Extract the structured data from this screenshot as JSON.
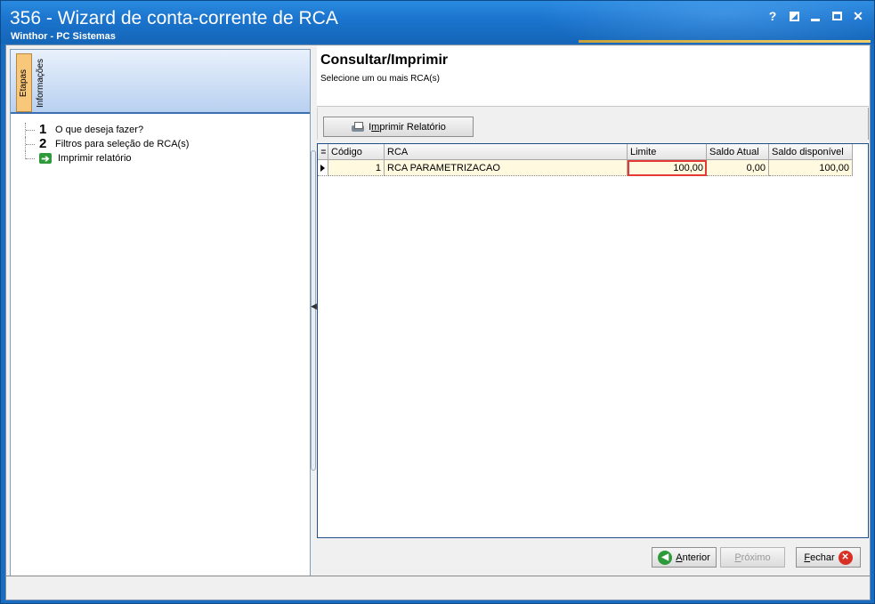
{
  "window": {
    "title": "356 - Wizard de conta-corrente de RCA",
    "subtitle": "Winthor - PC Sistemas",
    "help_label": "?"
  },
  "left_tabs": [
    {
      "label": "Etapas",
      "active": true
    },
    {
      "label": "Informações",
      "active": false
    }
  ],
  "steps": [
    {
      "number": "1",
      "label": "O que deseja fazer?"
    },
    {
      "number": "2",
      "label": "Filtros para seleção de RCA(s)"
    },
    {
      "number": "",
      "label": "Imprimir relatório",
      "current": true,
      "icon": "green-arrow-icon"
    }
  ],
  "header": {
    "title": "Consultar/Imprimir",
    "subtitle": "Selecione um ou mais RCA(s)"
  },
  "toolbar": {
    "print_label_pre": "I",
    "print_label_u": "m",
    "print_label_post": "primir Relatório"
  },
  "grid": {
    "columns": [
      "Código",
      "RCA",
      "Limite",
      "Saldo Atual",
      "Saldo disponível"
    ],
    "rows": [
      {
        "codigo": "1",
        "rca": "RCA PARAMETRIZACAO",
        "limite": "100,00",
        "saldo_atual": "0,00",
        "saldo_disponivel": "100,00"
      }
    ]
  },
  "footer": {
    "prev_u": "A",
    "prev_rest": "nterior",
    "next_u": "P",
    "next_rest": "róximo",
    "close_u": "F",
    "close_rest": "echar"
  },
  "colors": {
    "title_bg": "#1a73cc",
    "active_tab": "#f9c77a",
    "row_bg": "#fff9e0",
    "highlight": "#e53935"
  }
}
